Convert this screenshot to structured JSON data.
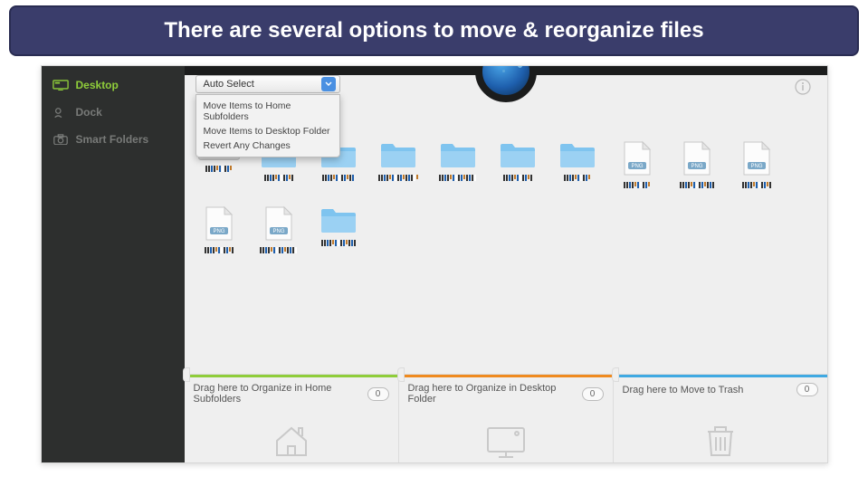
{
  "caption": "There are several options to move & reorganize files",
  "sidebar": {
    "items": [
      {
        "label": "Desktop",
        "icon": "desktop-icon",
        "active": true
      },
      {
        "label": "Dock",
        "icon": "dock-icon",
        "active": false
      },
      {
        "label": "Smart Folders",
        "icon": "camera-icon",
        "active": false
      }
    ]
  },
  "dropdown": {
    "selected": "Auto Select",
    "options": [
      "Move Items to Home Subfolders",
      "Move Items to Desktop Folder",
      "Revert Any Changes"
    ]
  },
  "grid": {
    "items": [
      {
        "type": "keyboard"
      },
      {
        "type": "folder"
      },
      {
        "type": "folder"
      },
      {
        "type": "folder"
      },
      {
        "type": "folder"
      },
      {
        "type": "folder"
      },
      {
        "type": "folder"
      },
      {
        "type": "png"
      },
      {
        "type": "png"
      },
      {
        "type": "png"
      },
      {
        "type": "png"
      },
      {
        "type": "png"
      },
      {
        "type": "folder"
      }
    ]
  },
  "dropzones": [
    {
      "label": "Drag here to Organize in Home Subfolders",
      "count": "0",
      "color": "green",
      "icon": "house"
    },
    {
      "label": "Drag here to Organize in Desktop Folder",
      "count": "0",
      "color": "orange",
      "icon": "desktop"
    },
    {
      "label": "Drag here to Move to Trash",
      "count": "0",
      "color": "blue",
      "icon": "trash"
    }
  ]
}
